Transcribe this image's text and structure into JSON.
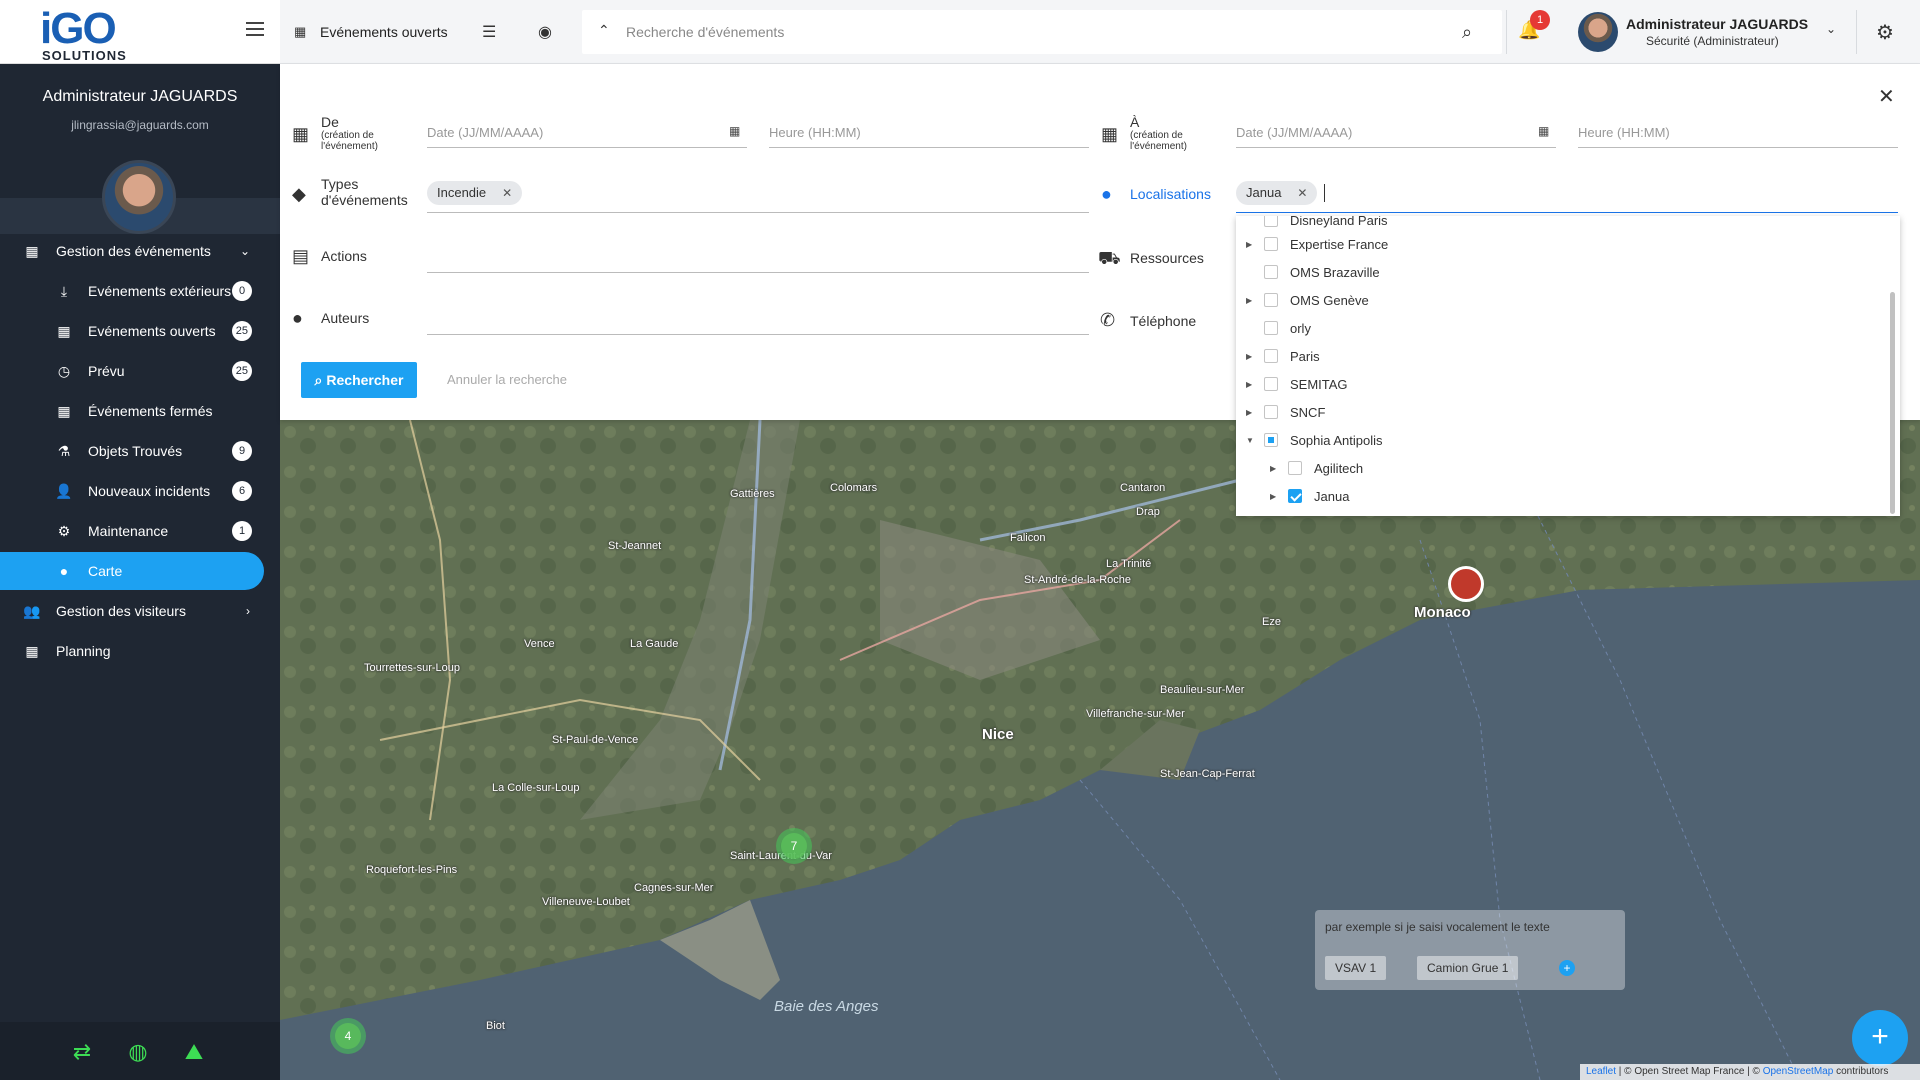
{
  "app": {
    "logo_text": "iGO",
    "logo_sub": "SOLUTIONS"
  },
  "sidebar": {
    "user_name": "Administrateur JAGUARDS",
    "user_email": "jlingrassia@jaguards.com",
    "items": [
      {
        "label": "Gestion des événements",
        "icon": "calendar-icon",
        "count": "",
        "chevron": "⌄"
      },
      {
        "label": "Evénements extérieurs",
        "icon": "download-icon",
        "count": "0"
      },
      {
        "label": "Evénements ouverts",
        "icon": "calendar-check-icon",
        "count": "25"
      },
      {
        "label": "Prévu",
        "icon": "clock-icon",
        "count": "25"
      },
      {
        "label": "Événements fermés",
        "icon": "calendar-x-icon",
        "count": ""
      },
      {
        "label": "Objets Trouvés",
        "icon": "flask-icon",
        "count": "9"
      },
      {
        "label": "Nouveaux incidents",
        "icon": "user-plus-icon",
        "count": "6"
      },
      {
        "label": "Maintenance",
        "icon": "gear-icon",
        "count": "1"
      },
      {
        "label": "Carte",
        "icon": "map-pin-icon",
        "count": ""
      },
      {
        "label": "Gestion des visiteurs",
        "icon": "users-icon",
        "count": "",
        "chevron": "›"
      },
      {
        "label": "Planning",
        "icon": "calendar-icon",
        "count": ""
      }
    ]
  },
  "topbar": {
    "title": "Evénements ouverts",
    "search_placeholder": "Recherche d'événements",
    "notification_count": "1",
    "user_name": "Administrateur JAGUARDS",
    "user_role": "Sécurité (Administrateur)"
  },
  "panel": {
    "from": {
      "label": "De",
      "sublabel": "(création de l'événement)",
      "date_placeholder": "Date (JJ/MM/AAAA)",
      "time_placeholder": "Heure (HH:MM)"
    },
    "to": {
      "label": "À",
      "sublabel": "(création de l'événement)",
      "date_placeholder": "Date (JJ/MM/AAAA)",
      "time_placeholder": "Heure (HH:MM)"
    },
    "types": {
      "label": "Types d'événements",
      "chip": "Incendie"
    },
    "locations": {
      "label": "Localisations",
      "chip": "Janua"
    },
    "actions_label": "Actions",
    "resources_label": "Ressources",
    "authors_label": "Auteurs",
    "phone_label": "Téléphone",
    "search_button": "Rechercher",
    "cancel_button": "Annuler la recherche"
  },
  "dropdown": {
    "items": [
      {
        "label": "Disneyland Paris",
        "level": 0,
        "expandable": false,
        "state": "unchecked"
      },
      {
        "label": "Expertise France",
        "level": 0,
        "expandable": true,
        "state": "unchecked"
      },
      {
        "label": "OMS Brazaville",
        "level": 0,
        "expandable": false,
        "state": "unchecked"
      },
      {
        "label": "OMS Genève",
        "level": 0,
        "expandable": true,
        "state": "unchecked"
      },
      {
        "label": "orly",
        "level": 0,
        "expandable": false,
        "state": "unchecked"
      },
      {
        "label": "Paris",
        "level": 0,
        "expandable": true,
        "state": "unchecked"
      },
      {
        "label": "SEMITAG",
        "level": 0,
        "expandable": true,
        "state": "unchecked"
      },
      {
        "label": "SNCF",
        "level": 0,
        "expandable": true,
        "state": "unchecked"
      },
      {
        "label": "Sophia Antipolis",
        "level": 0,
        "expandable": true,
        "expanded": true,
        "state": "partial"
      },
      {
        "label": "Agilitech",
        "level": 1,
        "expandable": true,
        "state": "unchecked"
      },
      {
        "label": "Janua",
        "level": 1,
        "expandable": true,
        "state": "checked"
      }
    ]
  },
  "map": {
    "popup_text": "par exemple si je saisi vocalement le texte",
    "popup_chips": [
      "VSAV 1",
      "Camion Grue 1"
    ],
    "clusters": [
      "7",
      "4"
    ],
    "labels": {
      "nice": "Nice",
      "monaco": "Monaco",
      "baie": "Baie des Anges",
      "vence": "Vence",
      "gattieres": "Gattières",
      "colomars": "Colomars",
      "la_trinite": "La Trinité",
      "eze": "Eze",
      "cagnes": "Cagnes-sur-Mer",
      "st_laurent": "Saint-Laurent-du-Var",
      "villefranche": "Villefranche-sur-Mer",
      "beaulieu": "Beaulieu-sur-Mer",
      "st_jean": "St-Jean-Cap-Ferrat",
      "la_gaude": "La Gaude",
      "st_jeannet": "St-Jeannet",
      "falicon": "Falicon",
      "drap": "Drap",
      "cantaron": "Cantaron",
      "tourrettes": "Tourrettes-sur-Loup",
      "la_colle": "La Colle-sur-Loup",
      "st_paul": "St-Paul-de-Vence",
      "roquefort": "Roquefort-les-Pins",
      "villeneuve": "Villeneuve-Loubet",
      "biot": "Biot",
      "st_andre": "St-André-de-la-Roche"
    },
    "attribution": {
      "leaflet": "Leaflet",
      "osm_fr": " | © Open Street Map France | © ",
      "osm": "OpenStreetMap",
      "contributors": " contributors"
    }
  },
  "colors": {
    "accent": "#1da1f2",
    "sidebar_bg": "#1f2733",
    "badge_red": "#e53935",
    "green": "#3ddc54"
  }
}
